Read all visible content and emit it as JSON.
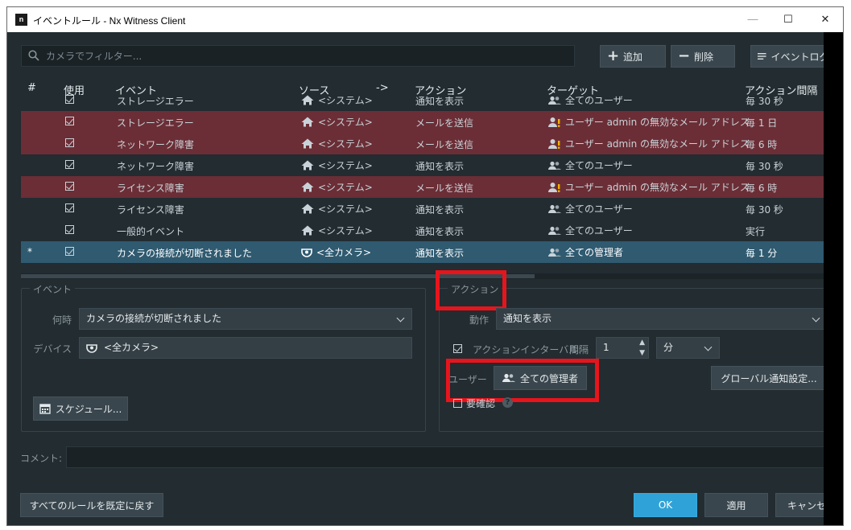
{
  "window": {
    "title": "イベントルール - Nx Witness Client",
    "app_icon_text": "n",
    "minimize": "—",
    "maximize": "☐",
    "close": "✕"
  },
  "search": {
    "placeholder": "カメラでフィルター..."
  },
  "toolbar": {
    "add_label": "追加",
    "delete_label": "削除",
    "event_log_label": "イベントログ..."
  },
  "table": {
    "headers": {
      "num": "#",
      "use": "使用",
      "event": "イベント",
      "source": "ソース",
      "arrow": "->",
      "action": "アクション",
      "target": "ターゲット",
      "interval": "アクション間隔"
    },
    "rows": [
      {
        "num": "",
        "event": "ストレージエラー",
        "source": "<システム>",
        "action": "通知を表示",
        "target": "全てのユーザー",
        "interval": "毎 30 秒",
        "state": "normal",
        "target_warn": false,
        "source_icon": "home"
      },
      {
        "num": "",
        "event": "ストレージエラー",
        "source": "<システム>",
        "action": "メールを送信",
        "target": "ユーザー admin の無効なメール アドレス",
        "interval": "毎 1 日",
        "state": "error",
        "target_warn": true,
        "source_icon": "home"
      },
      {
        "num": "",
        "event": "ネットワーク障害",
        "source": "<システム>",
        "action": "メールを送信",
        "target": "ユーザー admin の無効なメール アドレス",
        "interval": "毎 6 時",
        "state": "error",
        "target_warn": true,
        "source_icon": "home"
      },
      {
        "num": "",
        "event": "ネットワーク障害",
        "source": "<システム>",
        "action": "通知を表示",
        "target": "全てのユーザー",
        "interval": "毎 30 秒",
        "state": "normal",
        "target_warn": false,
        "source_icon": "home"
      },
      {
        "num": "",
        "event": "ライセンス障害",
        "source": "<システム>",
        "action": "メールを送信",
        "target": "ユーザー admin の無効なメール アドレス",
        "interval": "毎 6 時",
        "state": "error",
        "target_warn": true,
        "source_icon": "home"
      },
      {
        "num": "",
        "event": "ライセンス障害",
        "source": "<システム>",
        "action": "通知を表示",
        "target": "全てのユーザー",
        "interval": "毎 30 秒",
        "state": "normal",
        "target_warn": false,
        "source_icon": "home"
      },
      {
        "num": "",
        "event": "一般的イベント",
        "source": "<システム>",
        "action": "通知を表示",
        "target": "全てのユーザー",
        "interval": "実行",
        "state": "normal",
        "target_warn": false,
        "source_icon": "home"
      },
      {
        "num": "*",
        "event": "カメラの接続が切断されました",
        "source": "<全カメラ>",
        "action": "通知を表示",
        "target": "全ての管理者",
        "interval": "毎 1 分",
        "state": "selected",
        "target_warn": false,
        "source_icon": "camera"
      }
    ]
  },
  "event_pane": {
    "legend": "イベント",
    "when_label": "何時",
    "when_value": "カメラの接続が切断されました",
    "device_label": "デバイス",
    "device_value": "<全カメラ>",
    "schedule_button": "スケジュール..."
  },
  "action_pane": {
    "legend": "アクション",
    "action_label": "動作",
    "action_value": "通知を表示",
    "interval_checkbox_label": "アクションインターバル:",
    "interval_label": "間隔",
    "interval_value": "1",
    "interval_unit": "分",
    "user_label": "ユーザー",
    "user_value": "全ての管理者",
    "global_button": "グローバル通知設定...",
    "confirm_label": "要確認"
  },
  "comment": {
    "label": "コメント:"
  },
  "footer": {
    "reset_button": "すべてのルールを既定に戻す",
    "ok_button": "OK",
    "apply_button": "適用",
    "cancel_button": "キャンセル"
  },
  "colors": {
    "background": "#222c31",
    "error_row": "#6b2e36",
    "selected_row": "#2f5a70",
    "ok_button": "#2fa3d8",
    "highlight": "#e8141c"
  },
  "icons": {
    "search": "search-icon",
    "add": "plus-icon",
    "delete": "minus-icon",
    "event_log": "list-icon",
    "home": "home-icon",
    "camera": "camera-icon",
    "users": "users-icon",
    "user_warning": "user-warning-icon",
    "calendar": "calendar-icon",
    "help": "help-icon"
  }
}
